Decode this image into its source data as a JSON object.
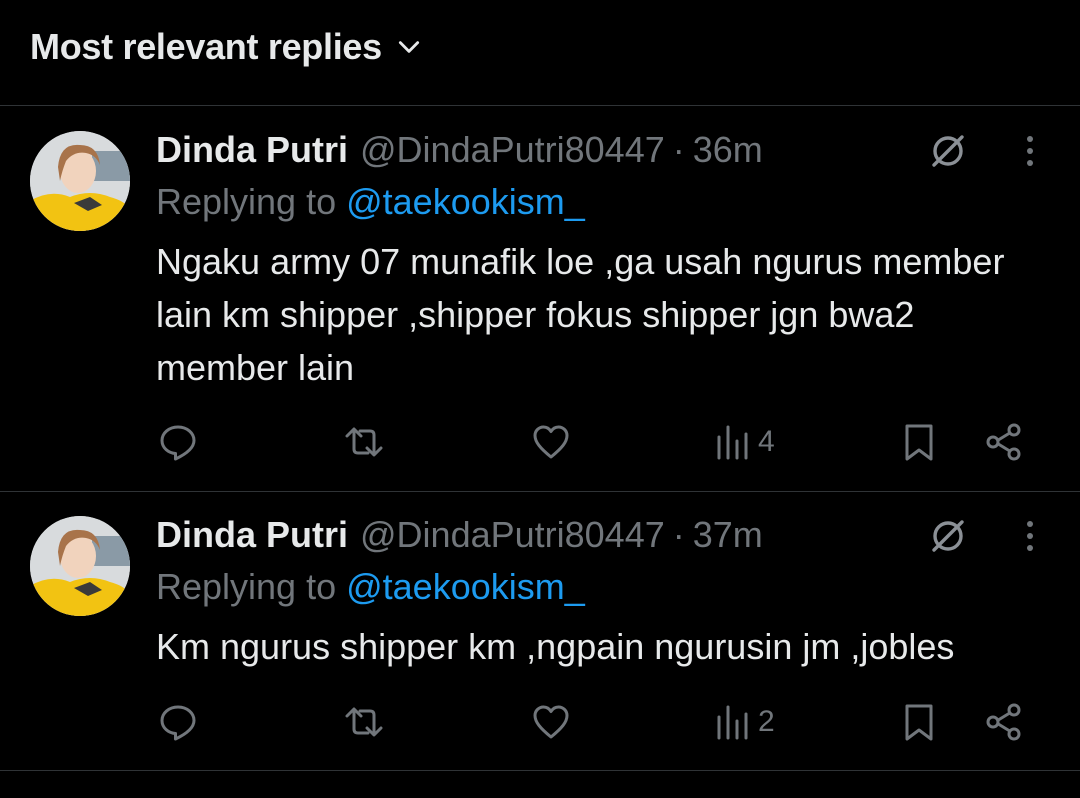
{
  "header": {
    "sort_label": "Most relevant replies",
    "chevron_icon": "chevron-down-icon"
  },
  "colors": {
    "background": "#000000",
    "text": "#e7e9ea",
    "secondary": "#71767b",
    "link": "#1d9bf0",
    "divider": "#2f3336"
  },
  "replies": [
    {
      "name": "Dinda Putri",
      "handle": "@DindaPutri80447",
      "separator": "·",
      "time": "36m",
      "replying_prefix": "Replying to ",
      "replying_to": "@taekookism_",
      "text": "Ngaku army 07 munafik loe ,ga usah ngurus member lain km shipper ,shipper fokus shipper jgn bwa2 member lain",
      "views": "4",
      "icons": [
        "reply-icon",
        "retweet-icon",
        "like-icon",
        "views-icon",
        "bookmark-icon",
        "share-icon",
        "grok-icon",
        "more-icon"
      ]
    },
    {
      "name": "Dinda Putri",
      "handle": "@DindaPutri80447",
      "separator": "·",
      "time": "37m",
      "replying_prefix": "Replying to ",
      "replying_to": "@taekookism_",
      "text": "Km ngurus shipper km ,ngpain ngurusin jm ,jobles",
      "views": "2",
      "icons": [
        "reply-icon",
        "retweet-icon",
        "like-icon",
        "views-icon",
        "bookmark-icon",
        "share-icon",
        "grok-icon",
        "more-icon"
      ]
    }
  ]
}
